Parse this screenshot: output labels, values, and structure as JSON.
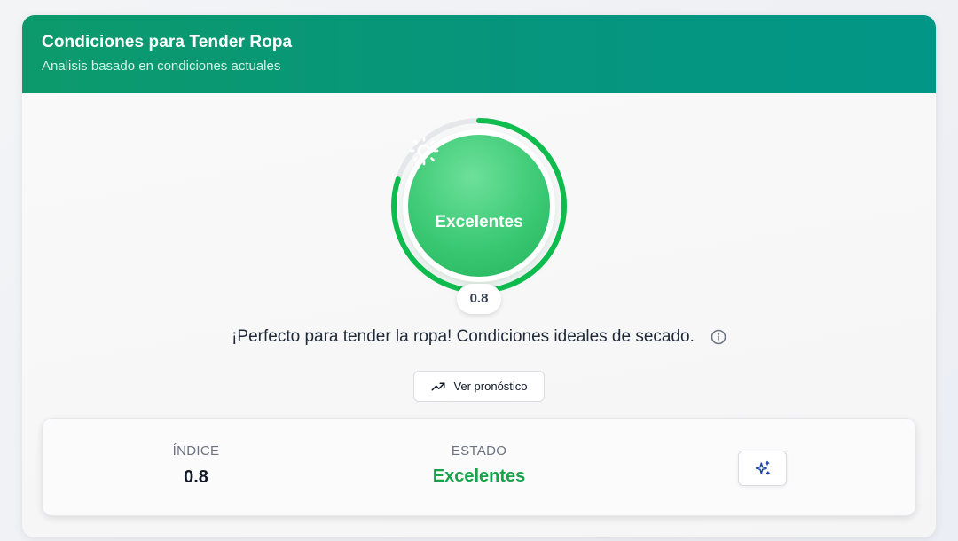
{
  "header": {
    "title": "Condiciones para Tender Ropa",
    "subtitle": "Analisis basado en condiciones actuales"
  },
  "gauge": {
    "label": "Excelentes",
    "value": "0.8",
    "fill_fraction": 0.8,
    "icon": "sun-icon",
    "color": "#0fbd4f"
  },
  "message": "¡Perfecto para tender la ropa! Condiciones ideales de secado.",
  "forecast_button": {
    "label": "Ver pronóstico",
    "icon": "trending-up-icon"
  },
  "stats": {
    "index_label": "ÍNDICE",
    "index_value": "0.8",
    "state_label": "ESTADO",
    "state_value": "Excelentes",
    "state_color": "#16a34a",
    "action_icon": "sparkles-icon"
  },
  "colors": {
    "header_start": "#0c9a6c",
    "header_end": "#029687",
    "accent": "#16a34a"
  }
}
